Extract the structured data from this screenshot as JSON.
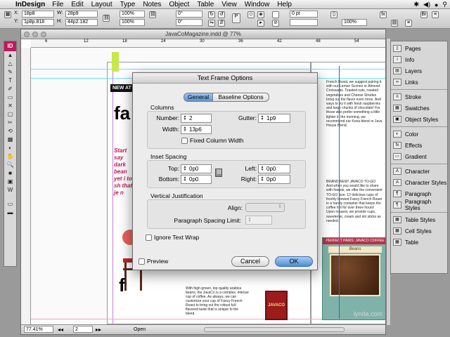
{
  "menubar": {
    "app": "InDesign",
    "items": [
      "File",
      "Edit",
      "Layout",
      "Type",
      "Notes",
      "Object",
      "Table",
      "View",
      "Window",
      "Help"
    ]
  },
  "controlbar": {
    "x_label": "X:",
    "x_value": "18p8",
    "y_label": "Y:",
    "y_value": "1p8p.818",
    "w_label": "W:",
    "w_value": "28p9",
    "h_label": "H:",
    "h_value": "44p2.182",
    "scale_x": "100%",
    "scale_y": "100%",
    "angle": "0°",
    "shear": "0°",
    "stroke_weight": "0 pt",
    "opacity": "100%"
  },
  "toolbox": {
    "logo": "ID",
    "tools": [
      "▲",
      "△",
      "✎",
      "T",
      "✐",
      "▭",
      "✕",
      "▢",
      "✂",
      "⟲",
      "▦",
      "◐",
      "✋",
      "🔍",
      "■",
      "▣",
      "W"
    ]
  },
  "document": {
    "title": "JavaCoMagazine.indd @ 77%",
    "zoom": "77.41%",
    "page": "2",
    "status": "Open",
    "ruler_marks": [
      "6",
      "12",
      "18",
      "24",
      "30",
      "36",
      "42",
      "48",
      "54"
    ],
    "headline_fragment": "fa",
    "banner_fragment": "NEW AT",
    "column_right_text": "French Roast, we suggest pairing it with our Lemon Scones or Almond Croissants. Toasted nuts, roasted vegetables and Cheese Strudes bring out the flavor even more. And ways to try it with fresh raspberries and large chunks of chocolate! For those who prefer something a little lighter in the morning, we recommend our Kona blend or Java House Blend.",
    "brand_new_text": "BRAND NEW! JAVACO TO-GO And when you would like to share with friends, we offer the convenient TO-GO size: 12 delicious cups of freshly brewed Fancy French Roast in a handy container that keeps the coffee hot for over three hours! Upon request, we provide cups, sweetener, cream and stir sticks as needed.",
    "bottom_column_text": "With high grown, top quality arabica beans, the JavaCo is a complex, intense cup of coffee. As always, we can customize your cup of Fancy French Roast to bring out the robust full-flavored taste that is unique to the blend.",
    "beans_label": "Beans",
    "pairs_heading": "PERFECT PAIRS: JAVACO COFFEE",
    "pink_story": "Start say dark bean yet i to sh that je n",
    "product_label": "JAVACO",
    "watermark": "lynda.com"
  },
  "panels": {
    "groups": [
      [
        "Pages",
        "Info",
        "Layers",
        "Links"
      ],
      [
        "Stroke",
        "Swatches",
        "Object Styles"
      ],
      [
        "Color",
        "Effects",
        "Gradient"
      ],
      [
        "Character",
        "Character Styles",
        "Paragraph",
        "Paragraph Styles"
      ],
      [
        "Table Styles",
        "Cell Styles",
        "Table"
      ]
    ]
  },
  "dialog": {
    "title": "Text Frame Options",
    "tabs": [
      "General",
      "Baseline Options"
    ],
    "columns": {
      "heading": "Columns",
      "number_label": "Number:",
      "number_value": "2",
      "gutter_label": "Gutter:",
      "gutter_value": "1p9",
      "width_label": "Width:",
      "width_value": "13p6",
      "fixed_label": "Fixed Column Width"
    },
    "inset": {
      "heading": "Inset Spacing",
      "top_label": "Top:",
      "top_value": "0p0",
      "bottom_label": "Bottom:",
      "bottom_value": "0p0",
      "left_label": "Left:",
      "left_value": "0p0",
      "right_label": "Right:",
      "right_value": "0p0"
    },
    "vertical": {
      "heading": "Vertical Justification",
      "align_label": "Align:",
      "align_value": "",
      "limit_label": "Paragraph Spacing Limit:",
      "limit_value": ""
    },
    "ignore_wrap_label": "Ignore Text Wrap",
    "preview_label": "Preview",
    "cancel_label": "Cancel",
    "ok_label": "OK"
  }
}
